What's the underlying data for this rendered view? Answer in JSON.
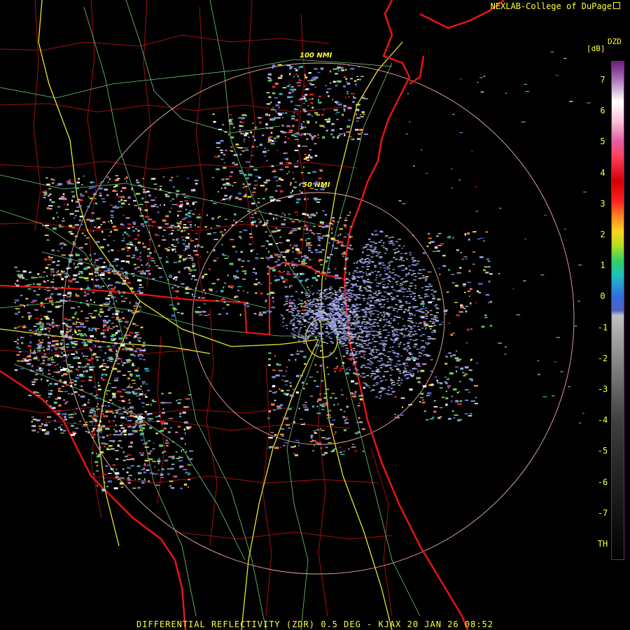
{
  "credit": "NEXLAB-College of DuPage",
  "credit_icon": "external-link-icon",
  "legend": {
    "product": "DZD",
    "unit": "[dB]",
    "ticks": [
      "7",
      "6",
      "5",
      "4",
      "3",
      "2",
      "1",
      "0",
      "-1",
      "-2",
      "-3",
      "-4",
      "-5",
      "-6",
      "-7",
      "TH"
    ]
  },
  "range_rings": {
    "inner": "50 NMI",
    "outer": "100 NMI"
  },
  "footer": "DIFFERENTIAL REFLECTIVITY (ZDR) 0.5 DEG - KJAX 20 JAN 26 08:52",
  "colors": {
    "background": "#000000",
    "coast_state_lines": "#e81515",
    "county_lines": "#a01010",
    "highways": "#ffff33",
    "roads": "#7fe07f",
    "range_ring": "#f0b0a0",
    "text": "#ffff33"
  }
}
